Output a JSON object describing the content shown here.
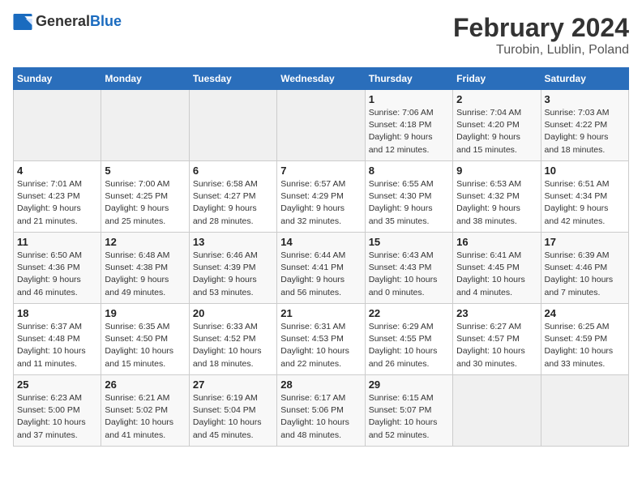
{
  "header": {
    "logo_general": "General",
    "logo_blue": "Blue",
    "main_title": "February 2024",
    "subtitle": "Turobin, Lublin, Poland"
  },
  "calendar": {
    "days_of_week": [
      "Sunday",
      "Monday",
      "Tuesday",
      "Wednesday",
      "Thursday",
      "Friday",
      "Saturday"
    ],
    "weeks": [
      [
        {
          "day": "",
          "info": ""
        },
        {
          "day": "",
          "info": ""
        },
        {
          "day": "",
          "info": ""
        },
        {
          "day": "",
          "info": ""
        },
        {
          "day": "1",
          "info": "Sunrise: 7:06 AM\nSunset: 4:18 PM\nDaylight: 9 hours\nand 12 minutes."
        },
        {
          "day": "2",
          "info": "Sunrise: 7:04 AM\nSunset: 4:20 PM\nDaylight: 9 hours\nand 15 minutes."
        },
        {
          "day": "3",
          "info": "Sunrise: 7:03 AM\nSunset: 4:22 PM\nDaylight: 9 hours\nand 18 minutes."
        }
      ],
      [
        {
          "day": "4",
          "info": "Sunrise: 7:01 AM\nSunset: 4:23 PM\nDaylight: 9 hours\nand 21 minutes."
        },
        {
          "day": "5",
          "info": "Sunrise: 7:00 AM\nSunset: 4:25 PM\nDaylight: 9 hours\nand 25 minutes."
        },
        {
          "day": "6",
          "info": "Sunrise: 6:58 AM\nSunset: 4:27 PM\nDaylight: 9 hours\nand 28 minutes."
        },
        {
          "day": "7",
          "info": "Sunrise: 6:57 AM\nSunset: 4:29 PM\nDaylight: 9 hours\nand 32 minutes."
        },
        {
          "day": "8",
          "info": "Sunrise: 6:55 AM\nSunset: 4:30 PM\nDaylight: 9 hours\nand 35 minutes."
        },
        {
          "day": "9",
          "info": "Sunrise: 6:53 AM\nSunset: 4:32 PM\nDaylight: 9 hours\nand 38 minutes."
        },
        {
          "day": "10",
          "info": "Sunrise: 6:51 AM\nSunset: 4:34 PM\nDaylight: 9 hours\nand 42 minutes."
        }
      ],
      [
        {
          "day": "11",
          "info": "Sunrise: 6:50 AM\nSunset: 4:36 PM\nDaylight: 9 hours\nand 46 minutes."
        },
        {
          "day": "12",
          "info": "Sunrise: 6:48 AM\nSunset: 4:38 PM\nDaylight: 9 hours\nand 49 minutes."
        },
        {
          "day": "13",
          "info": "Sunrise: 6:46 AM\nSunset: 4:39 PM\nDaylight: 9 hours\nand 53 minutes."
        },
        {
          "day": "14",
          "info": "Sunrise: 6:44 AM\nSunset: 4:41 PM\nDaylight: 9 hours\nand 56 minutes."
        },
        {
          "day": "15",
          "info": "Sunrise: 6:43 AM\nSunset: 4:43 PM\nDaylight: 10 hours\nand 0 minutes."
        },
        {
          "day": "16",
          "info": "Sunrise: 6:41 AM\nSunset: 4:45 PM\nDaylight: 10 hours\nand 4 minutes."
        },
        {
          "day": "17",
          "info": "Sunrise: 6:39 AM\nSunset: 4:46 PM\nDaylight: 10 hours\nand 7 minutes."
        }
      ],
      [
        {
          "day": "18",
          "info": "Sunrise: 6:37 AM\nSunset: 4:48 PM\nDaylight: 10 hours\nand 11 minutes."
        },
        {
          "day": "19",
          "info": "Sunrise: 6:35 AM\nSunset: 4:50 PM\nDaylight: 10 hours\nand 15 minutes."
        },
        {
          "day": "20",
          "info": "Sunrise: 6:33 AM\nSunset: 4:52 PM\nDaylight: 10 hours\nand 18 minutes."
        },
        {
          "day": "21",
          "info": "Sunrise: 6:31 AM\nSunset: 4:53 PM\nDaylight: 10 hours\nand 22 minutes."
        },
        {
          "day": "22",
          "info": "Sunrise: 6:29 AM\nSunset: 4:55 PM\nDaylight: 10 hours\nand 26 minutes."
        },
        {
          "day": "23",
          "info": "Sunrise: 6:27 AM\nSunset: 4:57 PM\nDaylight: 10 hours\nand 30 minutes."
        },
        {
          "day": "24",
          "info": "Sunrise: 6:25 AM\nSunset: 4:59 PM\nDaylight: 10 hours\nand 33 minutes."
        }
      ],
      [
        {
          "day": "25",
          "info": "Sunrise: 6:23 AM\nSunset: 5:00 PM\nDaylight: 10 hours\nand 37 minutes."
        },
        {
          "day": "26",
          "info": "Sunrise: 6:21 AM\nSunset: 5:02 PM\nDaylight: 10 hours\nand 41 minutes."
        },
        {
          "day": "27",
          "info": "Sunrise: 6:19 AM\nSunset: 5:04 PM\nDaylight: 10 hours\nand 45 minutes."
        },
        {
          "day": "28",
          "info": "Sunrise: 6:17 AM\nSunset: 5:06 PM\nDaylight: 10 hours\nand 48 minutes."
        },
        {
          "day": "29",
          "info": "Sunrise: 6:15 AM\nSunset: 5:07 PM\nDaylight: 10 hours\nand 52 minutes."
        },
        {
          "day": "",
          "info": ""
        },
        {
          "day": "",
          "info": ""
        }
      ]
    ]
  }
}
